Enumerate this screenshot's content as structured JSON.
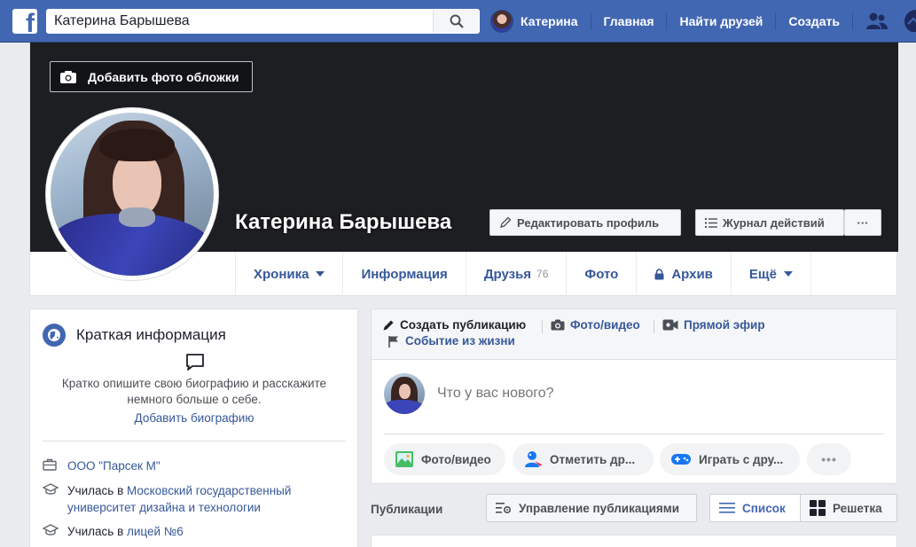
{
  "topbar": {
    "search_value": "Катерина Барышева",
    "user_name": "Катерина",
    "nav": [
      "Главная",
      "Найти друзей",
      "Создать"
    ],
    "colors": {
      "bar": "#4267b2",
      "link": "#365899"
    }
  },
  "cover": {
    "add_cover_label": "Добавить фото обложки",
    "profile_name": "Катерина Барышева",
    "edit_profile_label": "Редактировать профиль",
    "activity_log_label": "Журнал действий",
    "more_label": "···"
  },
  "tabs": {
    "timeline": "Хроника",
    "about": "Информация",
    "friends": "Друзья",
    "friends_count": "76",
    "photos": "Фото",
    "archive": "Архив",
    "more": "Ещё"
  },
  "intro": {
    "title": "Краткая информация",
    "bio_prompt": "Кратко опишите свою биографию и расскажите немного больше о себе.",
    "add_bio": "Добавить биографию",
    "work": "ООО \"Парсек М\"",
    "studied_prefix": "Училась в ",
    "university": "Московский государственный университет дизайна и технологии",
    "school_prefix": "Училась в ",
    "school": "лицей №6"
  },
  "composer": {
    "create_post": "Создать публикацию",
    "photo_video": "Фото/видео",
    "live": "Прямой эфир",
    "life_event": "Событие из жизни",
    "placeholder": "Что у вас нового?",
    "chip_photo": "Фото/видео",
    "chip_tag": "Отметить др...",
    "chip_game": "Играть с дру...",
    "chip_more": "•••"
  },
  "publications": {
    "label": "Публикации",
    "manage": "Управление публикациями",
    "list": "Список",
    "grid": "Решетка"
  }
}
